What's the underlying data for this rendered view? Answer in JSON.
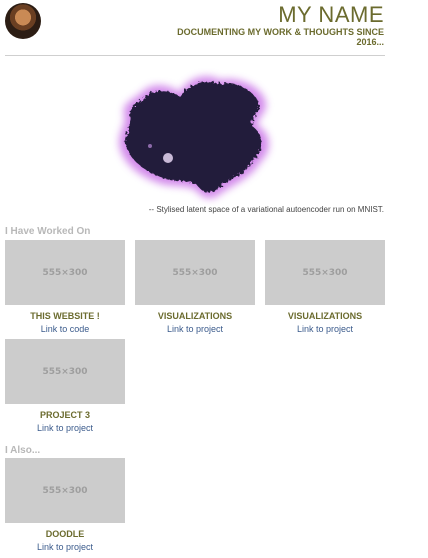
{
  "header": {
    "site_title": "MY NAME",
    "tagline": "DOCUMENTING MY WORK & THOUGHTS SINCE 2016..."
  },
  "hero": {
    "caption": "-- Stylised latent space of a variational autoencoder run on MNIST."
  },
  "sections": {
    "worked_on_heading": "I Have Worked On",
    "also_heading": "I Also..."
  },
  "projects": [
    {
      "thumb_label": "555×300",
      "title": "THIS WEBSITE !",
      "link": "Link to code"
    },
    {
      "thumb_label": "555×300",
      "title": "VISUALIZATIONS",
      "link": "Link to project"
    },
    {
      "thumb_label": "555×300",
      "title": "VISUALIZATIONS",
      "link": "Link to project"
    },
    {
      "thumb_label": "555×300",
      "title": "PROJECT 3",
      "link": "Link to project"
    }
  ],
  "also": [
    {
      "thumb_label": "555×300",
      "title": "DOODLE",
      "link": "Link to project"
    }
  ],
  "colors": {
    "accent": "#6b6b2e",
    "link": "#3b5b8c",
    "placeholder": "#cccccc",
    "blob": "#221a3a",
    "blob_glow": "#c86ee6"
  }
}
